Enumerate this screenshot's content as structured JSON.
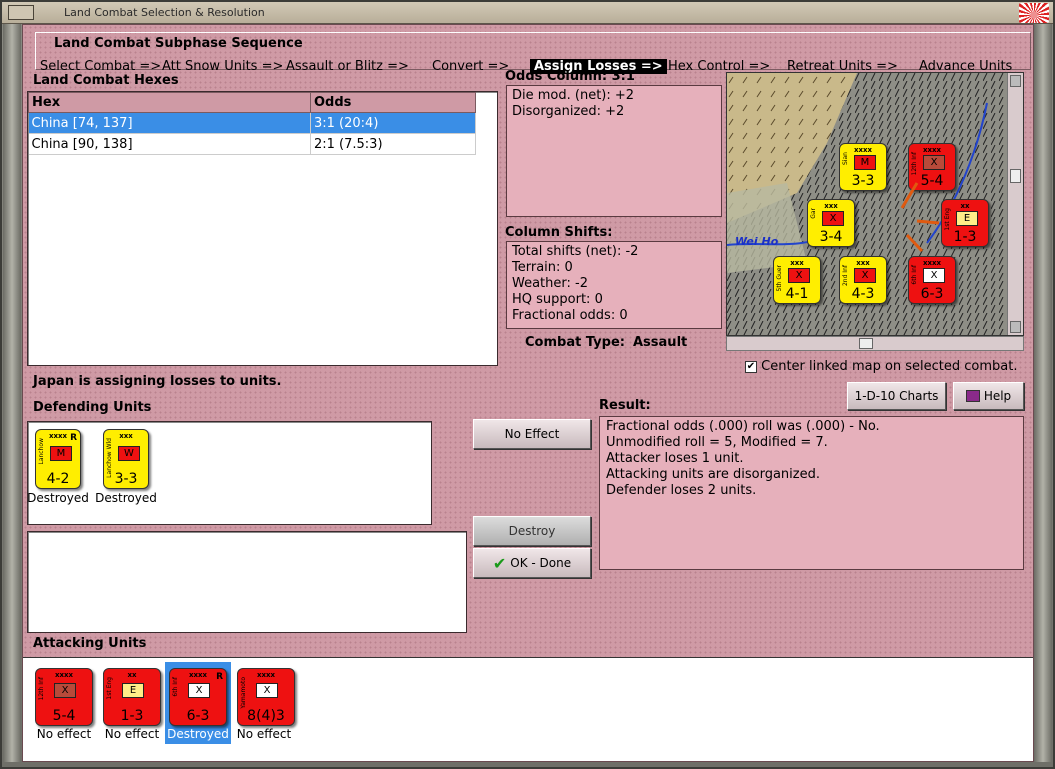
{
  "window": {
    "title": "Land Combat Selection & Resolution"
  },
  "sequence": {
    "title": "Land Combat Subphase Sequence",
    "steps": [
      {
        "label": "Select Combat =>",
        "active": false
      },
      {
        "label": "Att Snow Units =>",
        "active": false
      },
      {
        "label": "Assault or Blitz =>",
        "active": false
      },
      {
        "label": "Convert =>",
        "active": false
      },
      {
        "label": "Assign Losses =>",
        "active": true
      },
      {
        "label": "Hex Control =>",
        "active": false
      },
      {
        "label": "Retreat Units =>",
        "active": false
      },
      {
        "label": "Advance Units",
        "active": false
      }
    ]
  },
  "hexes": {
    "title": "Land Combat Hexes",
    "columns": [
      "Hex",
      "Odds"
    ],
    "rows": [
      {
        "hex": "China [74, 137]",
        "odds": "3:1 (20:4)",
        "selected": true
      },
      {
        "hex": "China [90, 138]",
        "odds": "2:1 (7.5:3)",
        "selected": false
      }
    ]
  },
  "odds": {
    "title": "Odds Column: 3:1",
    "lines": [
      "Die mod. (net): +2",
      "Disorganized: +2"
    ]
  },
  "shifts": {
    "title": "Column Shifts:",
    "lines": [
      "Total shifts (net): -2",
      "Terrain: 0",
      "Weather: -2",
      "HQ support: 0",
      "Fractional odds: 0"
    ]
  },
  "combat_type": {
    "label": "Combat Type:",
    "value": "Assault"
  },
  "map": {
    "center_label": "Center linked map on selected combat.",
    "center_checked": true,
    "place_label": "Wei Ho",
    "counters": [
      {
        "color": "yellow",
        "size": "xxxx",
        "sym": "M",
        "str": "3-3",
        "name": "Sian"
      },
      {
        "color": "red",
        "size": "xxxx",
        "sym": "X",
        "str": "5-4",
        "name": "12th Inf"
      },
      {
        "color": "yellow",
        "size": "xxx",
        "sym": "X",
        "str": "3-4",
        "name": "Gar"
      },
      {
        "color": "red",
        "size": "xx",
        "sym": "E",
        "str": "1-3",
        "name": "1st Eng"
      },
      {
        "color": "yellow",
        "size": "xxx",
        "sym": "X",
        "str": "4-1",
        "name": "5th Guer"
      },
      {
        "color": "yellow",
        "size": "xxx",
        "sym": "X",
        "str": "4-3",
        "name": "2nd Inf"
      },
      {
        "color": "red",
        "size": "xxxx",
        "sym": "X",
        "str": "6-3",
        "name": "6th Inf"
      }
    ]
  },
  "status": "Japan is assigning losses to units.",
  "defending": {
    "title": "Defending Units",
    "units": [
      {
        "size": "xxxx",
        "sym": "M",
        "str": "4-2",
        "name": "Lanchow",
        "flag": "R",
        "status": "Destroyed"
      },
      {
        "size": "xxx",
        "sym": "W",
        "str": "3-3",
        "name": "Lanchow Wld",
        "flag": "",
        "status": "Destroyed"
      }
    ]
  },
  "buttons": {
    "no_effect": "No Effect",
    "destroy": "Destroy",
    "ok_done": "OK - Done",
    "charts": "1-D-10 Charts",
    "help": "Help"
  },
  "result": {
    "title": "Result:",
    "lines": [
      "Fractional odds (.000) roll was (.000)  - No.",
      "Unmodified roll = 5, Modified = 7.",
      "Attacker loses 1 unit.",
      "Attacking units are disorganized.",
      "Defender loses 2 units."
    ]
  },
  "attacking": {
    "title": "Attacking Units",
    "units": [
      {
        "size": "xxxx",
        "sym": "X",
        "str": "5-4",
        "name": "12th Inf",
        "flag": "",
        "status": "No effect",
        "selected": false
      },
      {
        "size": "xx",
        "sym": "E",
        "str": "1-3",
        "name": "1st Eng",
        "flag": "",
        "status": "No effect",
        "selected": false
      },
      {
        "size": "xxxx",
        "sym": "X",
        "str": "6-3",
        "name": "6th Inf",
        "flag": "R",
        "status": "Destroyed",
        "selected": true
      },
      {
        "size": "xxxx",
        "sym": "X",
        "str": "8(4)3",
        "name": "Yamamoto",
        "flag": "",
        "status": "No effect",
        "selected": false
      }
    ]
  },
  "colors": {
    "selection": "#3a8ee6",
    "panel": "#cf9aa5",
    "unit_red": "#ee1111",
    "unit_yellow": "#ffee00"
  }
}
